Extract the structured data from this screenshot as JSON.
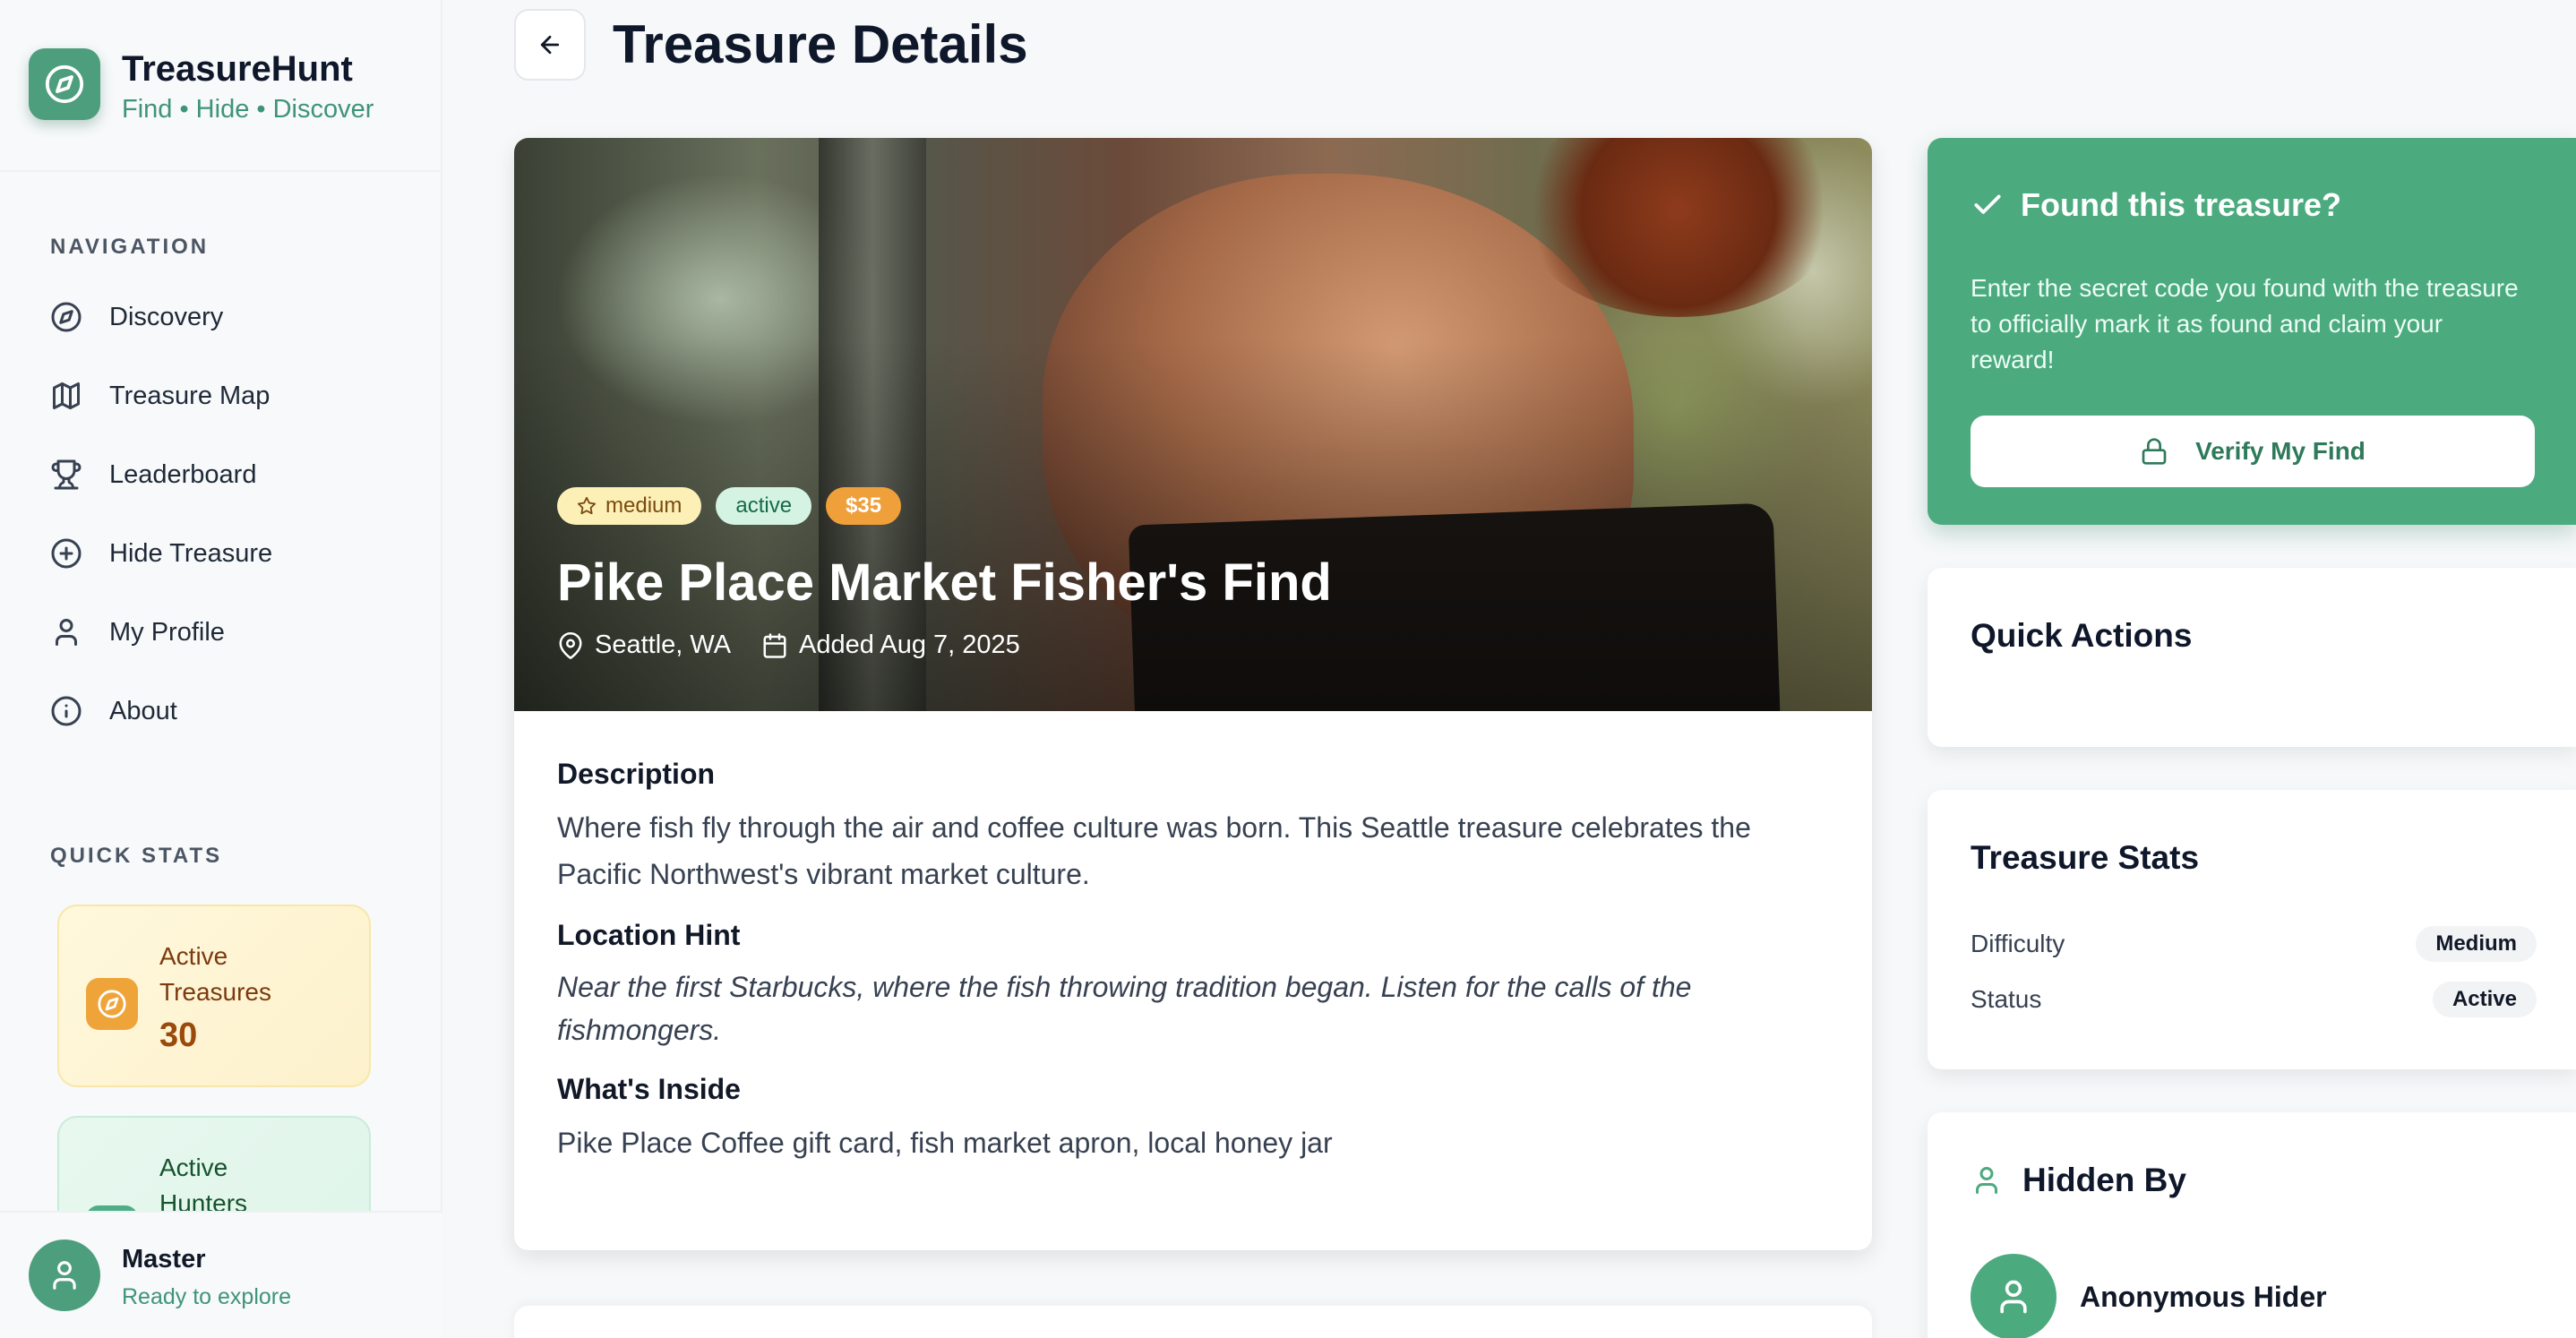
{
  "brand": {
    "title": "TreasureHunt",
    "tagline": "Find • Hide • Discover"
  },
  "sidebar": {
    "nav_heading": "NAVIGATION",
    "items": [
      {
        "label": "Discovery",
        "icon": "compass-icon"
      },
      {
        "label": "Treasure Map",
        "icon": "map-icon"
      },
      {
        "label": "Leaderboard",
        "icon": "trophy-icon"
      },
      {
        "label": "Hide Treasure",
        "icon": "plus-circle-icon"
      },
      {
        "label": "My Profile",
        "icon": "user-icon"
      },
      {
        "label": "About",
        "icon": "info-icon"
      }
    ],
    "stats_heading": "QUICK STATS",
    "stats": [
      {
        "label": "Active Treasures",
        "value": "30",
        "icon": "compass-icon"
      },
      {
        "label": "Active Hunters",
        "icon": "users-icon"
      }
    ]
  },
  "user": {
    "name": "Master",
    "status": "Ready to explore"
  },
  "header": {
    "title": "Treasure Details"
  },
  "treasure": {
    "difficulty_badge": "medium",
    "status_badge": "active",
    "price_badge": "$35",
    "title": "Pike Place Market Fisher's Find",
    "location": "Seattle, WA",
    "added": "Added Aug 7, 2025",
    "description_heading": "Description",
    "description": "Where fish fly through the air and coffee culture was born. This Seattle treasure celebrates the Pacific Northwest's vibrant market culture.",
    "hint_heading": "Location Hint",
    "hint": "Near the first Starbucks, where the fish throwing tradition began. Listen for the calls of the fishmongers.",
    "inside_heading": "What's Inside",
    "inside": "Pike Place Coffee gift card, fish market apron, local honey jar"
  },
  "found_card": {
    "title": "Found this treasure?",
    "text": "Enter the secret code you found with the treasure to officially mark it as found and claim your reward!",
    "button": "Verify My Find"
  },
  "quick_actions": {
    "title": "Quick Actions"
  },
  "treasure_stats": {
    "title": "Treasure Stats",
    "rows": [
      {
        "label": "Difficulty",
        "value": "Medium"
      },
      {
        "label": "Status",
        "value": "Active"
      }
    ]
  },
  "hidden_by": {
    "title": "Hidden By",
    "name": "Anonymous Hider"
  },
  "colors": {
    "accent": "#4caa7f",
    "brand_text": "#3f9477",
    "price_badge": "#f0a03a"
  }
}
